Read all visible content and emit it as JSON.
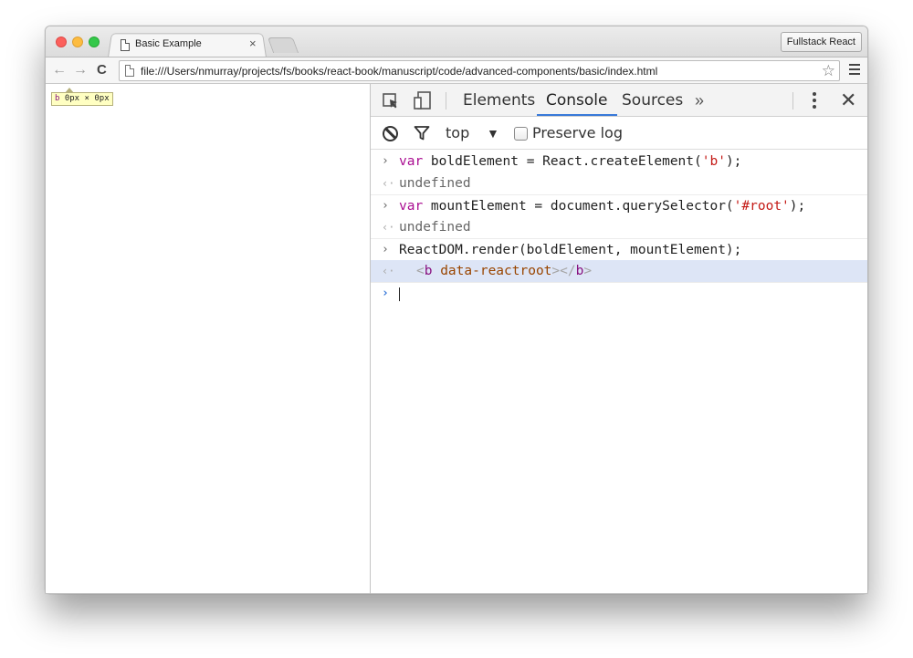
{
  "window": {
    "tab_title": "Basic Example",
    "tab_close": "×",
    "profile_button": "Fullstack React"
  },
  "toolbar": {
    "back_icon": "←",
    "forward_icon": "→",
    "reload_icon": "C",
    "url": "file:///Users/nmurray/projects/fs/books/react-book/manuscript/code/advanced-components/basic/index.html",
    "star_icon": "☆"
  },
  "page": {
    "inspect_tag": "b",
    "inspect_size": "0px × 0px"
  },
  "devtools": {
    "tabs": {
      "elements": "Elements",
      "console": "Console",
      "sources": "Sources",
      "more": "»"
    },
    "close_icon": "✕",
    "filter_bar": {
      "context": "top",
      "context_arrow": "▼",
      "preserve_log": "Preserve log",
      "preserve_log_checked": false
    },
    "console": {
      "input_prompt": "›",
      "result_prompt": "‹·",
      "line1_kw": "var",
      "line1_rest": " boldElement = React.createElement(",
      "line1_str": "'b'",
      "line1_end": ");",
      "line2": "undefined",
      "line3_kw": "var",
      "line3_rest": " mountElement = document.querySelector(",
      "line3_str": "'#root'",
      "line3_end": ");",
      "line4": "undefined",
      "line5": "ReactDOM.render(boldElement, mountElement);",
      "line6_open": "<",
      "line6_tag": "b",
      "line6_attr": " data-reactroot",
      "line6_close_open": "></",
      "line6_close_tag": "b",
      "line6_close_end": ">"
    }
  },
  "colors": {
    "accent": "#3879d9",
    "keyword": "#aa0d91",
    "string": "#c41a16",
    "tag": "#881280",
    "attribute": "#994500",
    "highlight_row": "#dde5f6"
  }
}
